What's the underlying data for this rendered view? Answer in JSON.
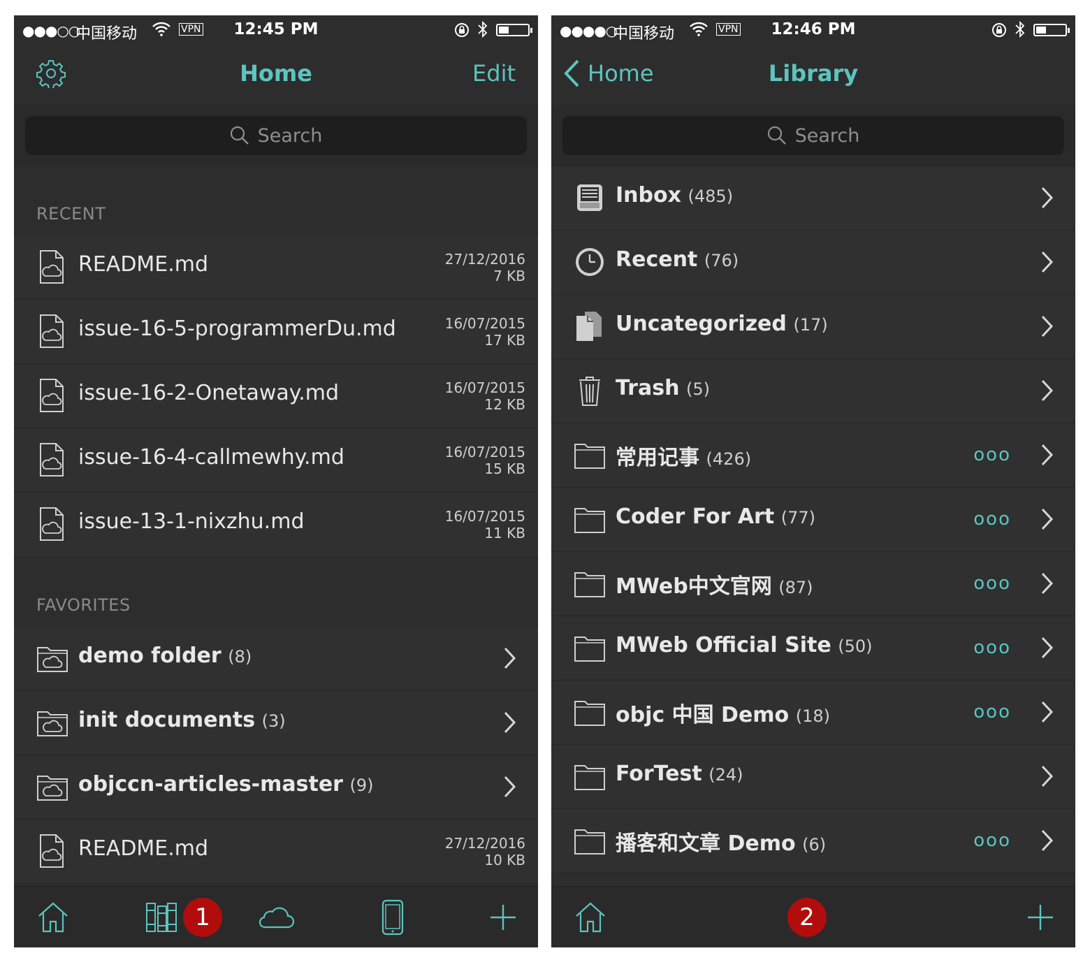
{
  "left": {
    "status": {
      "dots": "●●●○○",
      "carrier": "中国移动",
      "vpn": "VPN",
      "time": "12:45 PM"
    },
    "nav": {
      "title": "Home",
      "edit": "Edit"
    },
    "search": {
      "placeholder": "Search"
    },
    "recent_header": "RECENT",
    "recent": [
      {
        "name": "README.md",
        "date": "27/12/2016",
        "size": "7 KB"
      },
      {
        "name": "issue-16-5-programmerDu.md",
        "date": "16/07/2015",
        "size": "17 KB"
      },
      {
        "name": "issue-16-2-Onetaway.md",
        "date": "16/07/2015",
        "size": "12 KB"
      },
      {
        "name": "issue-16-4-callmewhy.md",
        "date": "16/07/2015",
        "size": "15 KB"
      },
      {
        "name": "issue-13-1-nixzhu.md",
        "date": "16/07/2015",
        "size": "11 KB"
      }
    ],
    "favorites_header": "FAVORITES",
    "favorites": [
      {
        "name": "demo folder",
        "count": "(8)"
      },
      {
        "name": "init documents",
        "count": "(3)"
      },
      {
        "name": "objccn-articles-master",
        "count": "(9)"
      }
    ],
    "favorite_file": {
      "name": "README.md",
      "date": "27/12/2016",
      "size": "10 KB"
    },
    "badge": "1"
  },
  "right": {
    "status": {
      "dots": "●●●●○",
      "carrier": "中国移动",
      "vpn": "VPN",
      "time": "12:46 PM"
    },
    "nav": {
      "back": "Home",
      "title": "Library"
    },
    "search": {
      "placeholder": "Search"
    },
    "items": [
      {
        "name": "Inbox",
        "count": "(485)",
        "icon": "inbox-icon",
        "more": ""
      },
      {
        "name": "Recent",
        "count": "(76)",
        "icon": "clock-icon",
        "more": ""
      },
      {
        "name": "Uncategorized",
        "count": "(17)",
        "icon": "documents-icon",
        "more": ""
      },
      {
        "name": "Trash",
        "count": "(5)",
        "icon": "trash-icon",
        "more": ""
      },
      {
        "name": "常用记事",
        "count": "(426)",
        "icon": "folder-icon",
        "more": "ooo"
      },
      {
        "name": "Coder For Art",
        "count": "(77)",
        "icon": "folder-icon",
        "more": "ooo"
      },
      {
        "name": "MWeb中文官网",
        "count": "(87)",
        "icon": "folder-icon",
        "more": "ooo"
      },
      {
        "name": "MWeb Official Site",
        "count": "(50)",
        "icon": "folder-icon",
        "more": "ooo"
      },
      {
        "name": "objc 中国 Demo",
        "count": "(18)",
        "icon": "folder-icon",
        "more": "ooo"
      },
      {
        "name": "ForTest",
        "count": "(24)",
        "icon": "folder-icon",
        "more": ""
      },
      {
        "name": "播客和文章 Demo",
        "count": "(6)",
        "icon": "folder-icon",
        "more": "ooo"
      }
    ],
    "badge": "2"
  },
  "colors": {
    "accent": "#5bc5bf",
    "background": "#2d2d2d",
    "badge": "#b10d0d"
  }
}
